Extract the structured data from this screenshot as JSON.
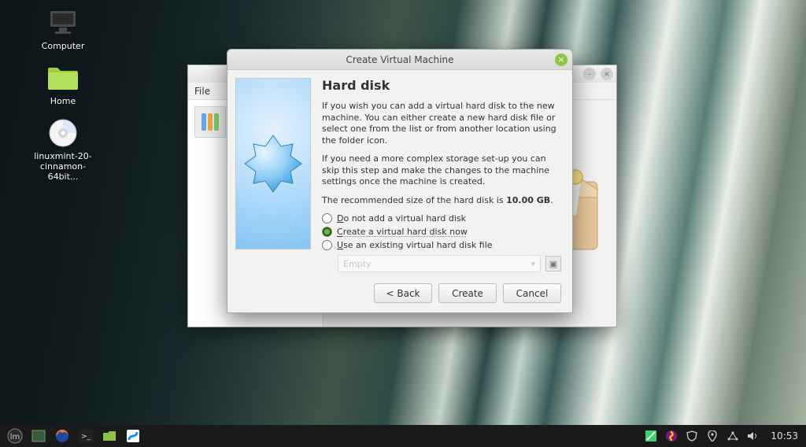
{
  "desktop": {
    "icons": [
      {
        "label": "Computer"
      },
      {
        "label": "Home"
      },
      {
        "label": "linuxmint-20-cinnamon-64bit..."
      }
    ]
  },
  "vbox": {
    "menubar": {
      "file": "File"
    }
  },
  "dialog": {
    "title": "Create Virtual Machine",
    "heading": "Hard disk",
    "p1": "If you wish you can add a virtual hard disk to the new machine. You can either create a new hard disk file or select one from the list or from another location using the folder icon.",
    "p2": "If you need a more complex storage set-up you can skip this step and make the changes to the machine settings once the machine is created.",
    "p3_pre": "The recommended size of the hard disk is ",
    "p3_size": "10.00 GB",
    "p3_post": ".",
    "opt1_pre": "D",
    "opt1_rest": "o not add a virtual hard disk",
    "opt2_pre": "C",
    "opt2_rest": "reate a virtual hard disk now",
    "opt3_pre": "U",
    "opt3_rest": "se an existing virtual hard disk file",
    "combo_value": "Empty",
    "back": "< Back",
    "create": "Create",
    "cancel": "Cancel"
  },
  "taskbar": {
    "clock": "10:53"
  }
}
